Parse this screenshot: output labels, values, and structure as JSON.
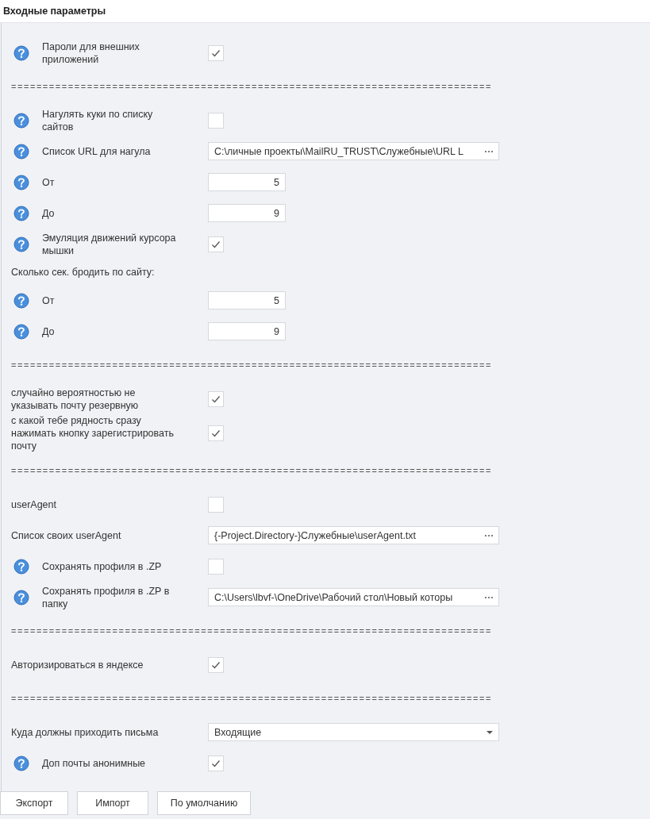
{
  "title": "Входные параметры",
  "rows": [
    {
      "kind": "checkbox",
      "help": true,
      "label": "Пароли для внешних приложений",
      "checked": true
    },
    {
      "kind": "separator",
      "text": "============================================================================"
    },
    {
      "kind": "checkbox",
      "help": true,
      "label": "Нагулять куки по списку сайтов",
      "checked": false
    },
    {
      "kind": "path",
      "help": true,
      "label": "Список URL для нагула",
      "value": "C:\\личные проекты\\MailRU_TRUST\\Служебные\\URL L"
    },
    {
      "kind": "number",
      "help": true,
      "label": "От",
      "value": "5"
    },
    {
      "kind": "number",
      "help": true,
      "label": "До",
      "value": "9"
    },
    {
      "kind": "checkbox",
      "help": true,
      "label": "Эмуляция движений курсора мышки",
      "checked": true
    },
    {
      "kind": "heading",
      "label": "Сколько сек. бродить по сайту:"
    },
    {
      "kind": "number",
      "help": true,
      "label": "От",
      "value": "5"
    },
    {
      "kind": "number",
      "help": true,
      "label": "До",
      "value": "9"
    },
    {
      "kind": "separator",
      "text": "============================================================================"
    },
    {
      "kind": "checkbox",
      "help": false,
      "label": "случайно вероятностью не указывать почту резервную",
      "checked": true
    },
    {
      "kind": "checkbox",
      "help": false,
      "label": "с какой тебе рядность сразу нажимать кнопку зарегистрировать почту",
      "checked": true
    },
    {
      "kind": "separator",
      "text": "============================================================================"
    },
    {
      "kind": "checkbox",
      "help": false,
      "label": "userAgent",
      "checked": false
    },
    {
      "kind": "path",
      "help": false,
      "label": "Список своих userAgent",
      "value": "{-Project.Directory-}Служебные\\userAgent.txt"
    },
    {
      "kind": "checkbox",
      "help": true,
      "label": "Сохранять профиля в .ZP",
      "checked": false
    },
    {
      "kind": "path",
      "help": true,
      "label": "Сохранять профиля в .ZP в папку",
      "value": "C:\\Users\\lbvf-\\OneDrive\\Рабочий стол\\Новый которы"
    },
    {
      "kind": "separator",
      "text": "============================================================================"
    },
    {
      "kind": "checkbox",
      "help": false,
      "label": "Авторизироваться в яндексе",
      "checked": true
    },
    {
      "kind": "separator",
      "text": "============================================================================"
    },
    {
      "kind": "dropdown",
      "help": false,
      "label": "Куда должны приходить письма",
      "value": "Входящие"
    },
    {
      "kind": "checkbox",
      "help": true,
      "label": "Доп почты анонимные",
      "checked": true
    }
  ],
  "buttons": [
    "Экспорт",
    "Импорт",
    "По умолчанию"
  ]
}
